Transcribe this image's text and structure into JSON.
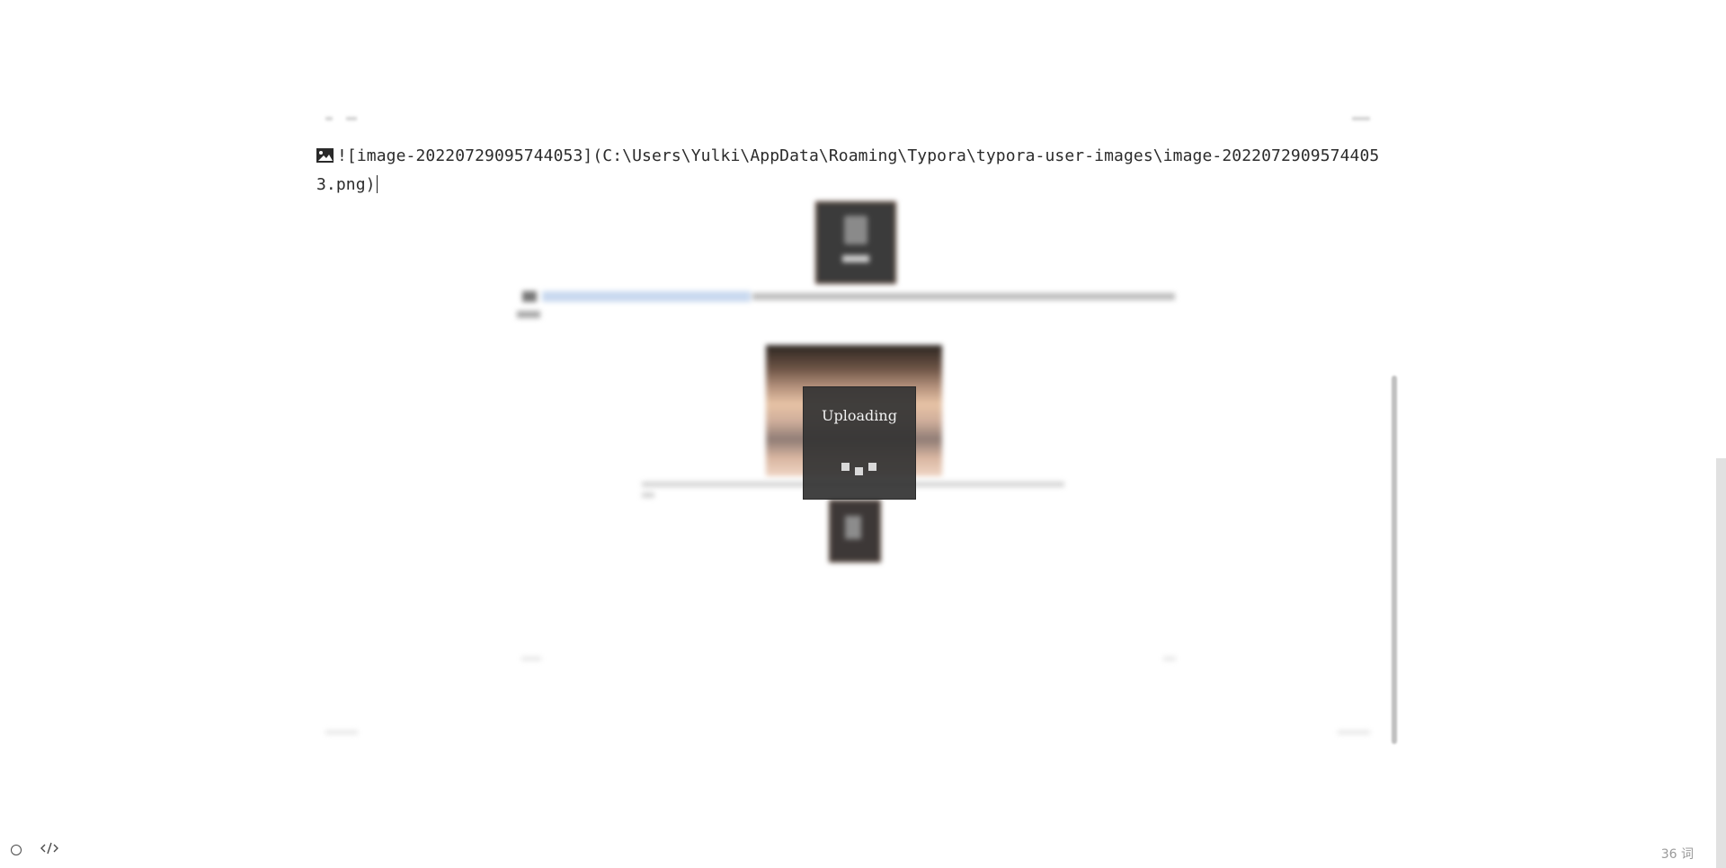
{
  "editor": {
    "markdown_image_line": "![image-20220729095744053](C:\\Users\\Yulki\\AppData\\Roaming\\Typora\\typora-user-images\\image-20220729095744053.png)"
  },
  "upload_overlay": {
    "label": "Uploading"
  },
  "status_bar": {
    "word_count": "36 词",
    "icons": [
      "circle-icon",
      "code-icon"
    ]
  }
}
